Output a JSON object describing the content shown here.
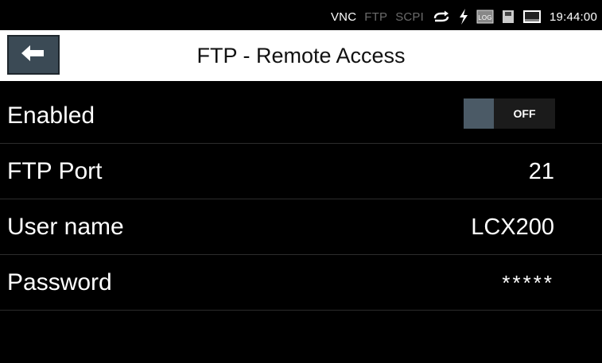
{
  "status_bar": {
    "vnc": "VNC",
    "ftp": "FTP",
    "scpi": "SCPI",
    "icons": [
      "sync-icon",
      "lightning-icon",
      "log-icon",
      "usb-storage-icon",
      "display-icon"
    ],
    "log_label": "LOG",
    "time": "19:44:00"
  },
  "header": {
    "title": "FTP - Remote Access",
    "back_icon": "arrow-left-icon"
  },
  "settings": {
    "enabled": {
      "label": "Enabled",
      "toggle_text": "OFF"
    },
    "ftp_port": {
      "label": "FTP Port",
      "value": "21"
    },
    "user_name": {
      "label": "User name",
      "value": "LCX200"
    },
    "password": {
      "label": "Password",
      "value": "*****"
    }
  },
  "colors": {
    "background": "#000000",
    "header_bg": "#ffffff",
    "accent": "#4b5a66",
    "inactive_status": "#6b6b6b"
  }
}
